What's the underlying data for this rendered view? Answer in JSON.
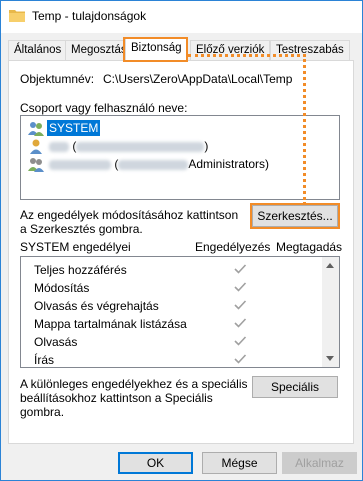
{
  "window": {
    "title": "Temp - tulajdonságok",
    "folder_icon": "folder-icon"
  },
  "tabs": [
    {
      "label": "Általános",
      "active": false
    },
    {
      "label": "Megosztás",
      "active": false
    },
    {
      "label": "Biztonság",
      "active": true
    },
    {
      "label": "Előző verziók",
      "active": false
    },
    {
      "label": "Testreszabás",
      "active": false
    }
  ],
  "object": {
    "label": "Objektumnév:",
    "value": "C:\\Users\\Zero\\AppData\\Local\\Temp"
  },
  "groups": {
    "label": "Csoport vagy felhasználó neve:",
    "items": [
      {
        "name": "SYSTEM",
        "selected": true
      },
      {
        "name": " (",
        "suffix": ")"
      },
      {
        "name": " (",
        "suffix": "Administrators)"
      }
    ]
  },
  "edit": {
    "hint": "Az engedélyek módosításához kattintson a Szerkesztés gombra.",
    "button": "Szerkesztés..."
  },
  "permissions": {
    "header": "SYSTEM engedélyei",
    "allow_label": "Engedélyezés",
    "deny_label": "Megtagadás",
    "rows": [
      {
        "name": "Teljes hozzáférés",
        "allow": true
      },
      {
        "name": "Módosítás",
        "allow": true
      },
      {
        "name": "Olvasás és végrehajtás",
        "allow": true
      },
      {
        "name": "Mappa tartalmának listázása",
        "allow": true
      },
      {
        "name": "Olvasás",
        "allow": true
      },
      {
        "name": "Írás",
        "allow": true
      }
    ]
  },
  "special": {
    "hint": "A különleges engedélyekhez és a speciális beállításokhoz kattintson a Speciális gombra.",
    "button": "Speciális"
  },
  "footer": {
    "ok": "OK",
    "cancel": "Mégse",
    "apply": "Alkalmaz"
  },
  "colors": {
    "accent": "#0078d7",
    "highlight": "#f28c28",
    "check_disabled": "#a0a0a0"
  }
}
